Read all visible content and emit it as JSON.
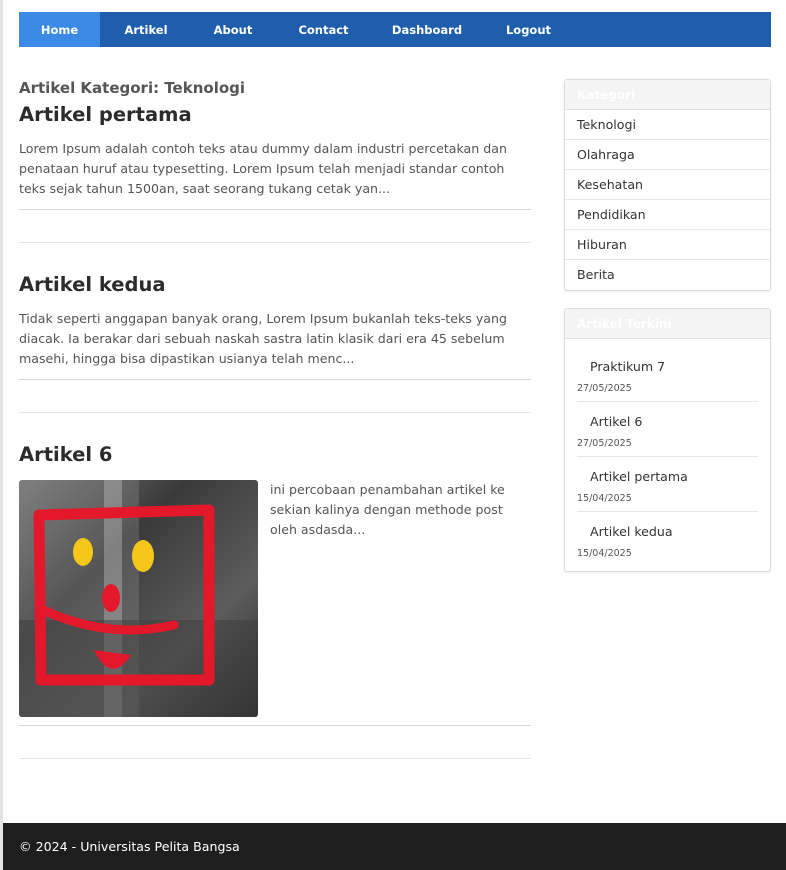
{
  "nav": {
    "items": [
      {
        "label": "Home"
      },
      {
        "label": "Artikel"
      },
      {
        "label": "About"
      },
      {
        "label": "Contact"
      },
      {
        "label": "Dashboard"
      },
      {
        "label": "Logout"
      }
    ]
  },
  "main": {
    "category_heading": "Artikel Kategori: Teknologi",
    "articles": [
      {
        "title": "Artikel pertama",
        "excerpt": "Lorem Ipsum adalah contoh teks atau dummy dalam industri percetakan dan penataan huruf atau typesetting. Lorem Ipsum telah menjadi standar contoh teks sejak tahun 1500an, saat seorang tukang cetak yan..."
      },
      {
        "title": "Artikel kedua",
        "excerpt": "Tidak seperti anggapan banyak orang, Lorem Ipsum bukanlah teks-teks yang diacak. Ia berakar dari sebuah naskah sastra latin klasik dari era 45 sebelum masehi, hingga bisa dipastikan usianya telah menc..."
      },
      {
        "title": "Artikel 6",
        "excerpt": "ini percobaan penambahan artikel ke sekian kalinya dengan methode post oleh asdasda..."
      }
    ]
  },
  "sidebar": {
    "categories_heading": "Kategori",
    "categories": [
      {
        "label": "Teknologi"
      },
      {
        "label": "Olahraga"
      },
      {
        "label": "Kesehatan"
      },
      {
        "label": "Pendidikan"
      },
      {
        "label": "Hiburan"
      },
      {
        "label": "Berita"
      }
    ],
    "recent_heading": "Artikel Terkini",
    "recent": [
      {
        "title": "Praktikum 7",
        "date": "27/05/2025"
      },
      {
        "title": "Artikel 6",
        "date": "27/05/2025"
      },
      {
        "title": "Artikel pertama",
        "date": "15/04/2025"
      },
      {
        "title": "Artikel kedua",
        "date": "15/04/2025"
      }
    ]
  },
  "footer": {
    "text": "© 2024 - Universitas Pelita Bangsa"
  },
  "colors": {
    "nav_bg": "#1f5eac",
    "nav_active": "#3b8ae6",
    "footer_bg": "#1e1e1e"
  }
}
